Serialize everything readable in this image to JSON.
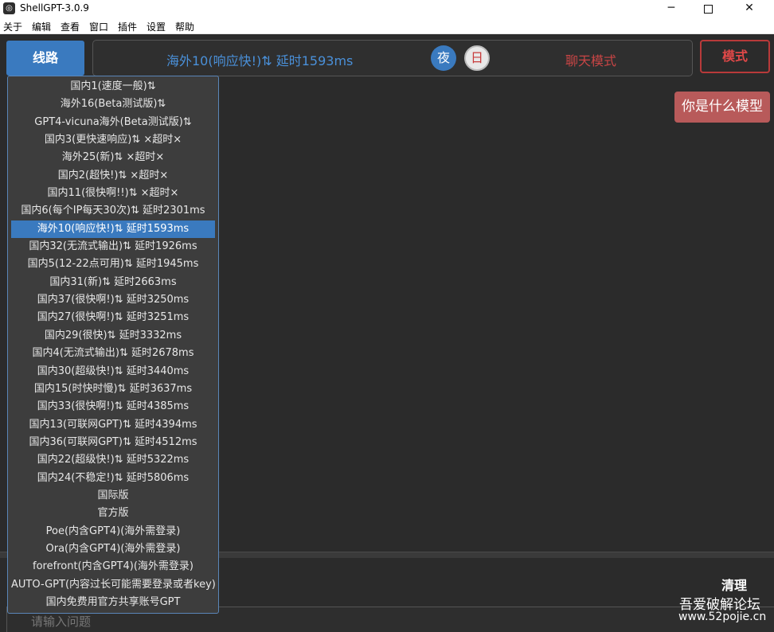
{
  "window": {
    "title": "ShellGPT-3.0.9"
  },
  "menu": [
    "关于",
    "编辑",
    "查看",
    "窗口",
    "插件",
    "设置",
    "帮助"
  ],
  "toolbar": {
    "route_label": "线路",
    "status_text": "海外10(响应快!)⇅ 延时1593ms",
    "night_label": "夜",
    "day_label": "日",
    "mode_text": "聊天模式",
    "mode_button": "模式"
  },
  "dropdown": {
    "selected_index": 8,
    "items": [
      "国内1(速度一般)⇅",
      "海外16(Beta测试版)⇅",
      "GPT4-vicuna海外(Beta测试版)⇅",
      "国内3(更快速响应)⇅ ×超时×",
      "海外25(新)⇅ ×超时×",
      "国内2(超快!)⇅ ×超时×",
      "国内11(很快啊!!)⇅ ×超时×",
      "国内6(每个IP每天30次)⇅ 延时2301ms",
      "海外10(响应快!)⇅ 延时1593ms",
      "国内32(无流式输出)⇅ 延时1926ms",
      "国内5(12-22点可用)⇅ 延时1945ms",
      "国内31(新)⇅ 延时2663ms",
      "国内37(很快啊!)⇅ 延时3250ms",
      "国内27(很快啊!)⇅ 延时3251ms",
      "国内29(很快)⇅ 延时3332ms",
      "国内4(无流式输出)⇅ 延时2678ms",
      "国内30(超级快!)⇅ 延时3440ms",
      "国内15(时快时慢)⇅ 延时3637ms",
      "国内33(很快啊!)⇅ 延时4385ms",
      "国内13(可联网GPT)⇅ 延时4394ms",
      "国内36(可联网GPT)⇅ 延时4512ms",
      "国内22(超级快!)⇅ 延时5322ms",
      "国内24(不稳定!)⇅ 延时5806ms",
      "国际版",
      "官方版",
      "Poe(内含GPT4)(海外需登录)",
      "Ora(内含GPT4)(海外需登录)",
      "forefront(内含GPT4)(海外需登录)",
      "AUTO-GPT(内容过长可能需要登录或者key)",
      "国内免费用官方共享账号GPT"
    ]
  },
  "chat": {
    "user_message": "你是什么模型"
  },
  "bottom": {
    "clear_label": "清理",
    "input_placeholder": "请输入问题",
    "forum_name": "吾爱破解论坛",
    "forum_url": "www.52pojie.cn"
  }
}
